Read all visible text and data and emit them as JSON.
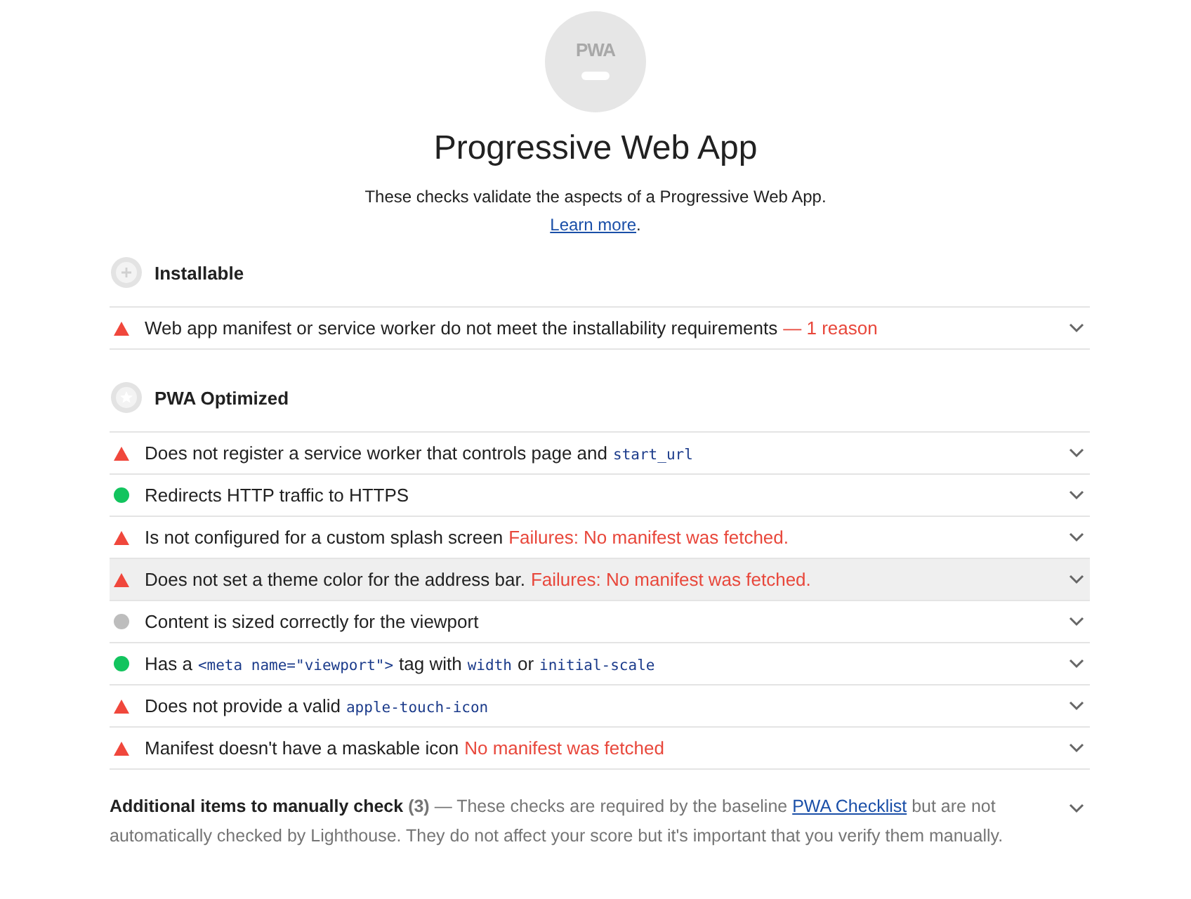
{
  "header": {
    "logo_text": "PWA",
    "title": "Progressive Web App",
    "description": "These checks validate the aspects of a Progressive Web App.",
    "link": "Learn more",
    "link_end": "."
  },
  "groups": [
    {
      "kind": "installable",
      "title": "Installable",
      "audits": [
        {
          "kind": "fail",
          "hovered": false,
          "parts": [
            {
              "kind": "text",
              "text": "Web app manifest or service worker do not meet the installability requirements"
            },
            {
              "kind": "failure",
              "text": "— 1 reason"
            }
          ]
        }
      ]
    },
    {
      "kind": "optimized",
      "title": "PWA Optimized",
      "audits": [
        {
          "kind": "fail",
          "hovered": false,
          "parts": [
            {
              "kind": "text",
              "text": "Does not register a service worker that controls page and"
            },
            {
              "kind": "code",
              "text": "start_url"
            }
          ]
        },
        {
          "kind": "pass",
          "hovered": false,
          "parts": [
            {
              "kind": "text",
              "text": "Redirects HTTP traffic to HTTPS"
            }
          ]
        },
        {
          "kind": "fail",
          "hovered": false,
          "parts": [
            {
              "kind": "text",
              "text": "Is not configured for a custom splash screen"
            },
            {
              "kind": "failure",
              "text": "Failures: No manifest was fetched."
            }
          ]
        },
        {
          "kind": "fail",
          "hovered": true,
          "parts": [
            {
              "kind": "text",
              "text": "Does not set a theme color for the address bar."
            },
            {
              "kind": "failure",
              "text": "Failures: No manifest was fetched."
            }
          ]
        },
        {
          "kind": "na",
          "hovered": false,
          "parts": [
            {
              "kind": "text",
              "text": "Content is sized correctly for the viewport"
            }
          ]
        },
        {
          "kind": "pass",
          "hovered": false,
          "parts": [
            {
              "kind": "text",
              "text": "Has a"
            },
            {
              "kind": "code",
              "text": "<meta name=\"viewport\">"
            },
            {
              "kind": "text",
              "text": "tag with"
            },
            {
              "kind": "code",
              "text": "width"
            },
            {
              "kind": "text",
              "text": "or"
            },
            {
              "kind": "code",
              "text": "initial-scale"
            }
          ]
        },
        {
          "kind": "fail",
          "hovered": false,
          "parts": [
            {
              "kind": "text",
              "text": "Does not provide a valid"
            },
            {
              "kind": "code",
              "text": "apple-touch-icon"
            }
          ]
        },
        {
          "kind": "fail",
          "hovered": false,
          "parts": [
            {
              "kind": "text",
              "text": "Manifest doesn't have a maskable icon"
            },
            {
              "kind": "failure",
              "text": "No manifest was fetched"
            }
          ]
        }
      ]
    }
  ],
  "manual": {
    "title": "Additional items to manually check",
    "count": "(3)",
    "text_before": "— These checks are required by the baseline",
    "link": "PWA Checklist",
    "text_after": "but are not automatically checked by Lighthouse. They do not affect your score but it's important that you verify them manually."
  }
}
